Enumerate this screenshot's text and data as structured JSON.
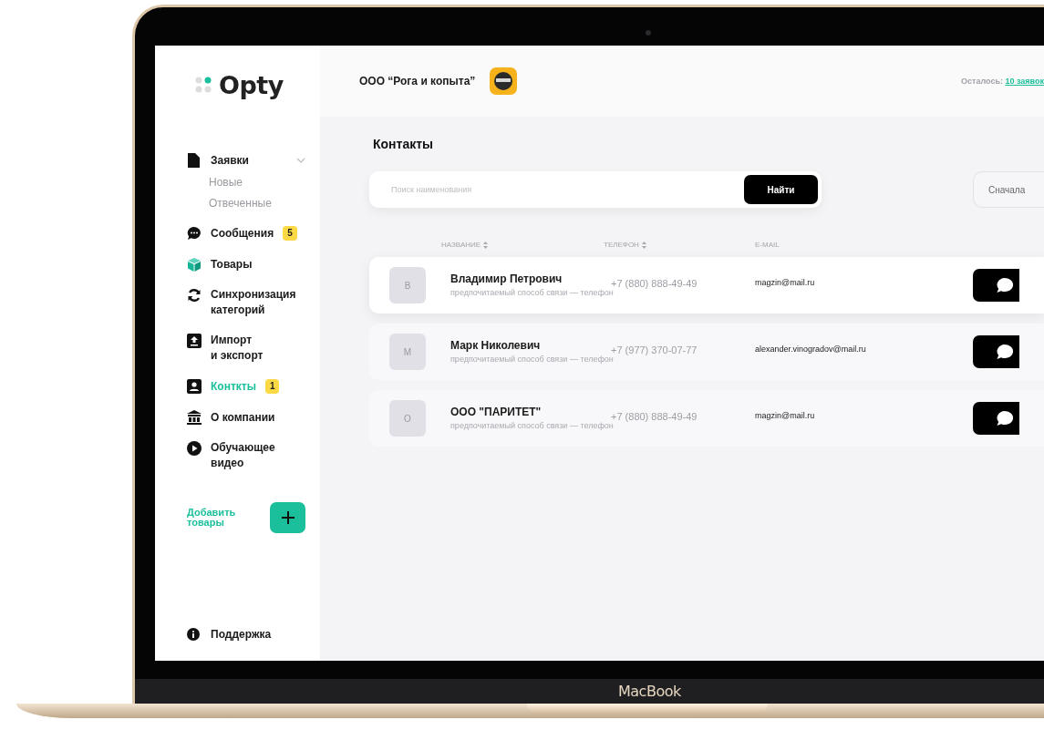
{
  "laptop": {
    "brand": "MacBook"
  },
  "sidebar": {
    "logo": "Opty",
    "items": [
      {
        "label": "Заявки",
        "selected": false,
        "expanded": true,
        "children": [
          {
            "label": "Новые"
          },
          {
            "label": "Отвеченные"
          }
        ]
      },
      {
        "label": "Сообщения",
        "selected": false,
        "badge": "5"
      },
      {
        "label": "Товары",
        "selected": false
      },
      {
        "label": "Синхронизация\nкатегорий",
        "selected": false
      },
      {
        "label": "Импорт\nи экспорт",
        "selected": false
      },
      {
        "label": "Конткты",
        "selected": true,
        "badge": "1"
      },
      {
        "label": "О компании",
        "selected": false
      },
      {
        "label": "Обучающее\nвидео",
        "selected": false
      }
    ],
    "add_products": "Добавить\nтовары",
    "support": "Поддержка"
  },
  "topbar": {
    "company": "ООО “Рога и копыта”",
    "remaining_label": "Осталось:",
    "remaining_link": "10 заявок"
  },
  "contacts": {
    "title": "Контакты",
    "search": {
      "placeholder": "Поиск наименования",
      "button": "Найти"
    },
    "sort_button": "Сначала",
    "columns": [
      {
        "label": "НАЗВАНИЕ",
        "sortable": true
      },
      {
        "label": "ТЕЛЕФОН",
        "sortable": true
      },
      {
        "label": "E-MAIL",
        "sortable": false
      }
    ],
    "rows": [
      {
        "initial": "В",
        "name": "Владимир Петрович",
        "note": "предпочитаемый способ связи — телефон",
        "phone": "+7 (880) 888-49-49",
        "email": "magzin@mail.ru",
        "selected": true
      },
      {
        "initial": "М",
        "name": "Марк Николевич",
        "note": "предпочитаемый способ связи — телефон",
        "phone": "+7 (977) 370-07-77",
        "email": "alexander.vinogradov@mail.ru",
        "selected": false
      },
      {
        "initial": "О",
        "name": "ООО \"ПАРИТЕТ\"",
        "note": "предпочитаемый способ связи — телефон",
        "phone": "+7 (880) 888-49-49",
        "email": "magzin@mail.ru",
        "selected": false
      }
    ]
  }
}
